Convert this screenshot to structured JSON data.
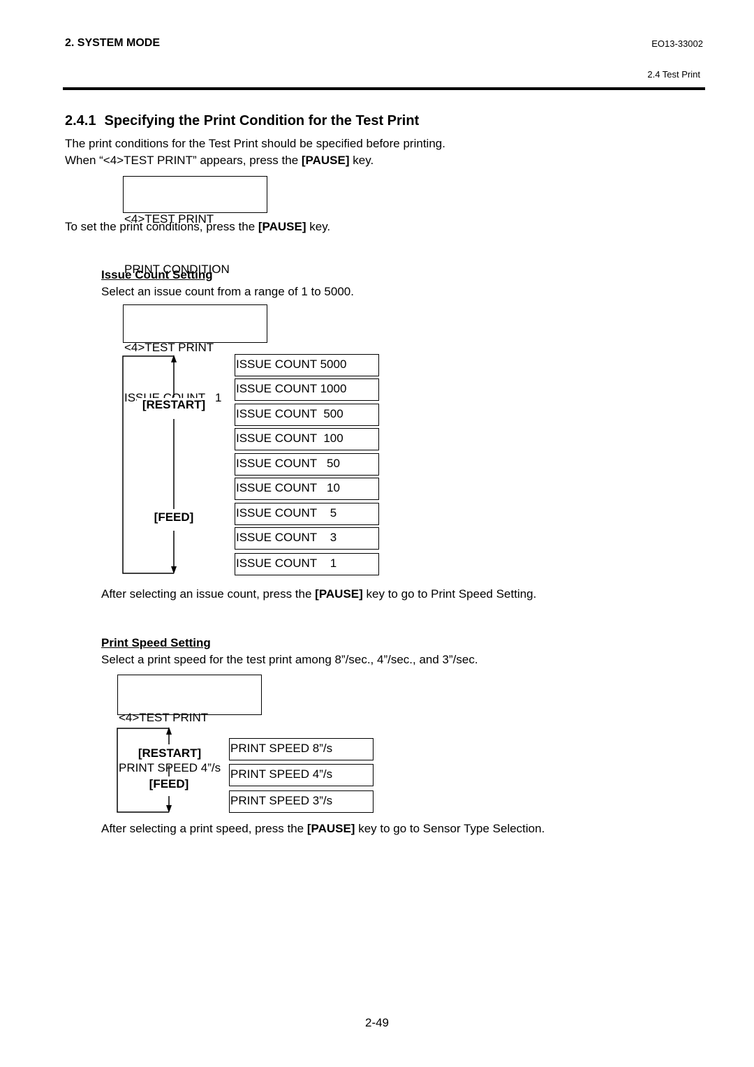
{
  "header": {
    "section": "2. SYSTEM MODE",
    "doc_id": "EO13-33002",
    "subsection": "2.4 Test Print"
  },
  "title": {
    "number": "2.4.1",
    "text": "Specifying the Print Condition for the Test Print"
  },
  "intro": {
    "line1": "The print conditions for the Test Print should be specified before printing.",
    "line2_pre": "When “<4>TEST PRINT” appears, press the ",
    "line2_key": "[PAUSE]",
    "line2_post": " key."
  },
  "lcd_condition": {
    "line1": "<4>TEST PRINT",
    "line2": "PRINT CONDITION"
  },
  "set_text": {
    "pre": "To set the print conditions, press the ",
    "key": "[PAUSE]",
    "post": " key."
  },
  "issue_count": {
    "heading": "Issue Count Setting",
    "description": "Select an issue count from a range of 1 to 5000.",
    "lcd": {
      "line1": "<4>TEST PRINT",
      "line2": "ISSUE COUNT   1"
    },
    "key_up": "[RESTART]",
    "key_down": "[FEED]",
    "options": [
      "ISSUE COUNT 5000",
      "ISSUE COUNT 1000",
      "ISSUE COUNT  500",
      "ISSUE COUNT  100",
      "ISSUE COUNT   50",
      "ISSUE COUNT   10",
      "ISSUE COUNT    5",
      "ISSUE COUNT    3",
      "ISSUE COUNT    1"
    ],
    "after_pre": "After selecting an issue count, press the ",
    "after_key": "[PAUSE]",
    "after_post": " key to go to Print Speed Setting."
  },
  "print_speed": {
    "heading": "Print Speed Setting",
    "description": "Select a print speed for the test print among 8”/sec., 4”/sec., and 3”/sec.",
    "lcd": {
      "line1": "<4>TEST PRINT",
      "line2": "PRINT SPEED 4”/s"
    },
    "key_up": "[RESTART]",
    "key_down": "[FEED]",
    "options": [
      "PRINT SPEED 8”/s",
      "PRINT SPEED 4”/s",
      "PRINT SPEED 3”/s"
    ],
    "after_pre": "After selecting a print speed, press the ",
    "after_key": "[PAUSE]",
    "after_post": " key to go to Sensor Type Selection."
  },
  "footer": {
    "page_number": "2-49"
  }
}
